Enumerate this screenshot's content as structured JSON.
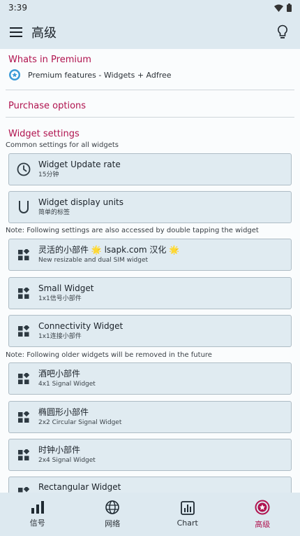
{
  "status_bar": {
    "time": "3:39"
  },
  "app_bar": {
    "title": "高级"
  },
  "sections": {
    "premium_header": "Whats in Premium",
    "premium_features": "Premium features - Widgets + Adfree",
    "purchase_header": "Purchase options",
    "widget_header": "Widget settings",
    "common_note": "Common settings for all widgets",
    "double_tap_note": "Note: Following settings are also accessed by double tapping the widget",
    "older_note": "Note: Following older widgets will be removed in the future"
  },
  "cards": {
    "update_rate": {
      "title": "Widget Update rate",
      "sub": "15分钟",
      "icon": "clock-icon"
    },
    "display_units": {
      "title": "Widget display units",
      "sub": "简单的标签",
      "icon": "units-icon"
    },
    "flexible": {
      "title": "灵活的小部件 🌟 lsapk.com 汉化 🌟",
      "sub": "New resizable and dual SIM widget",
      "icon": "widget-icon"
    },
    "small": {
      "title": "Small Widget",
      "sub": "1x1信号小部件",
      "icon": "widget-icon"
    },
    "connectivity": {
      "title": "Connectivity Widget",
      "sub": "1x1连接小部件",
      "icon": "widget-icon"
    },
    "bar": {
      "title": "酒吧小部件",
      "sub": "4x1 Signal Widget",
      "icon": "widget-icon"
    },
    "oval": {
      "title": "椭圆形小部件",
      "sub": "2x2 Circular Signal Widget",
      "icon": "widget-icon"
    },
    "clock": {
      "title": "时钟小部件",
      "sub": "2x4 Signal Widget",
      "icon": "widget-icon"
    },
    "rectangular": {
      "title": "Rectangular Widget",
      "sub": "",
      "icon": "widget-icon"
    }
  },
  "bottom_nav": [
    {
      "label": "信号",
      "icon": "signal-bars-icon"
    },
    {
      "label": "网络",
      "icon": "globe-icon"
    },
    {
      "label": "Chart",
      "icon": "chart-icon"
    },
    {
      "label": "高级",
      "icon": "premium-badge-icon"
    }
  ],
  "colors": {
    "accent": "#b0124e",
    "bar": "#dde9f0",
    "card": "#e0ebf1"
  }
}
